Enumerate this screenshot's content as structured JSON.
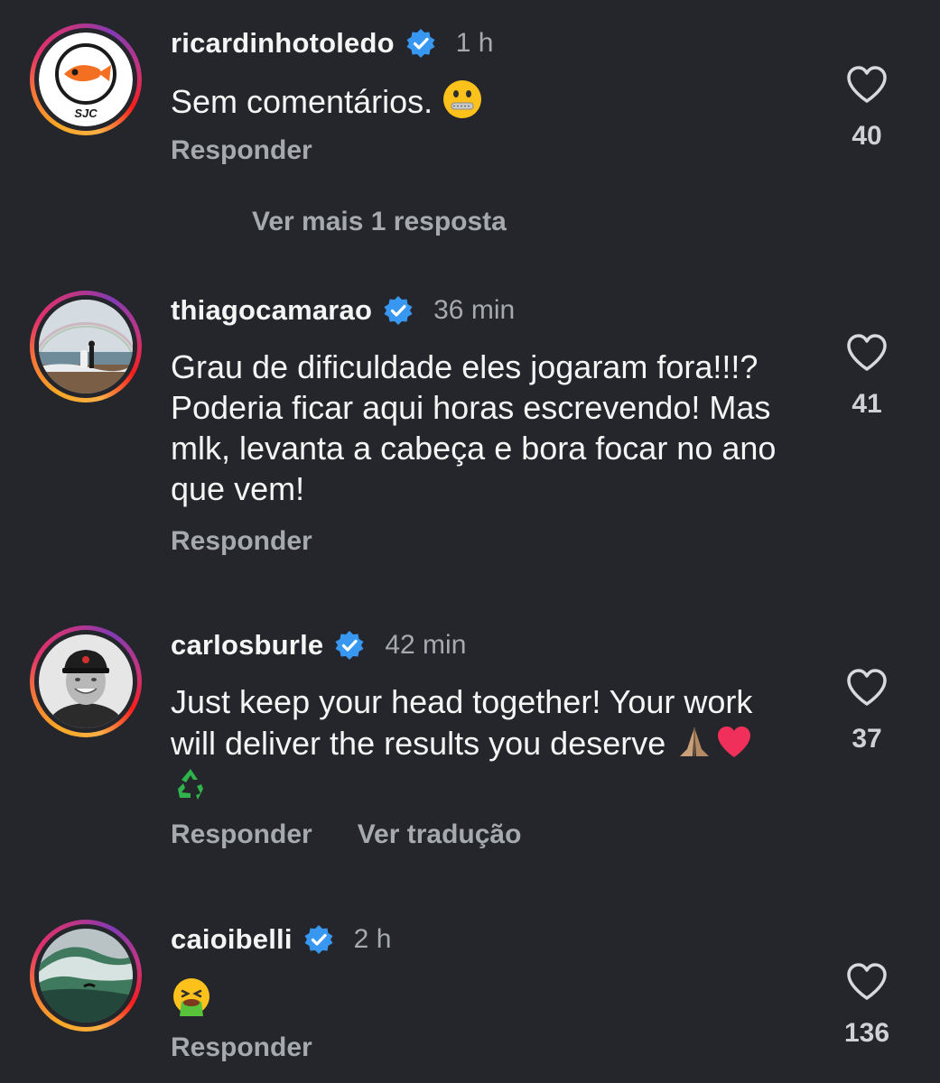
{
  "colors": {
    "background": "#24262b",
    "verified": "#3897f0",
    "secondary_text": "#a6a9ae"
  },
  "comments": [
    {
      "username": "ricardinhotoledo",
      "verified": true,
      "time": "1 h",
      "text": "Sem comentários.",
      "emojis": [
        "zipper-mouth-face"
      ],
      "actions": [
        "Responder"
      ],
      "likes": "40",
      "avatar": "sjc-fish-logo",
      "avatar_text": "SJC"
    },
    {
      "username": "thiagocamarao",
      "verified": true,
      "time": "36 min",
      "text": "Grau de dificuldade eles jogaram fora!!!? Poderia ficar aqui horas escrevendo! Mas mlk, levanta a cabeça e bora focar no ano que vem!",
      "actions": [
        "Responder"
      ],
      "likes": "41",
      "avatar": "beach-rainbow-photo"
    },
    {
      "username": "carlosburle",
      "verified": true,
      "time": "42 min",
      "text": "Just keep your head together! Your work will deliver the results you deserve",
      "emojis": [
        "folded-hands",
        "red-heart",
        "recycle-symbol"
      ],
      "actions": [
        "Responder",
        "Ver tradução"
      ],
      "likes": "37",
      "avatar": "man-with-cap-photo"
    },
    {
      "username": "caioibelli",
      "verified": true,
      "time": "2 h",
      "text": "",
      "emojis": [
        "vomiting-face"
      ],
      "actions": [
        "Responder"
      ],
      "likes": "136",
      "avatar": "big-wave-photo"
    }
  ],
  "view_more_replies": "Ver mais 1 resposta"
}
